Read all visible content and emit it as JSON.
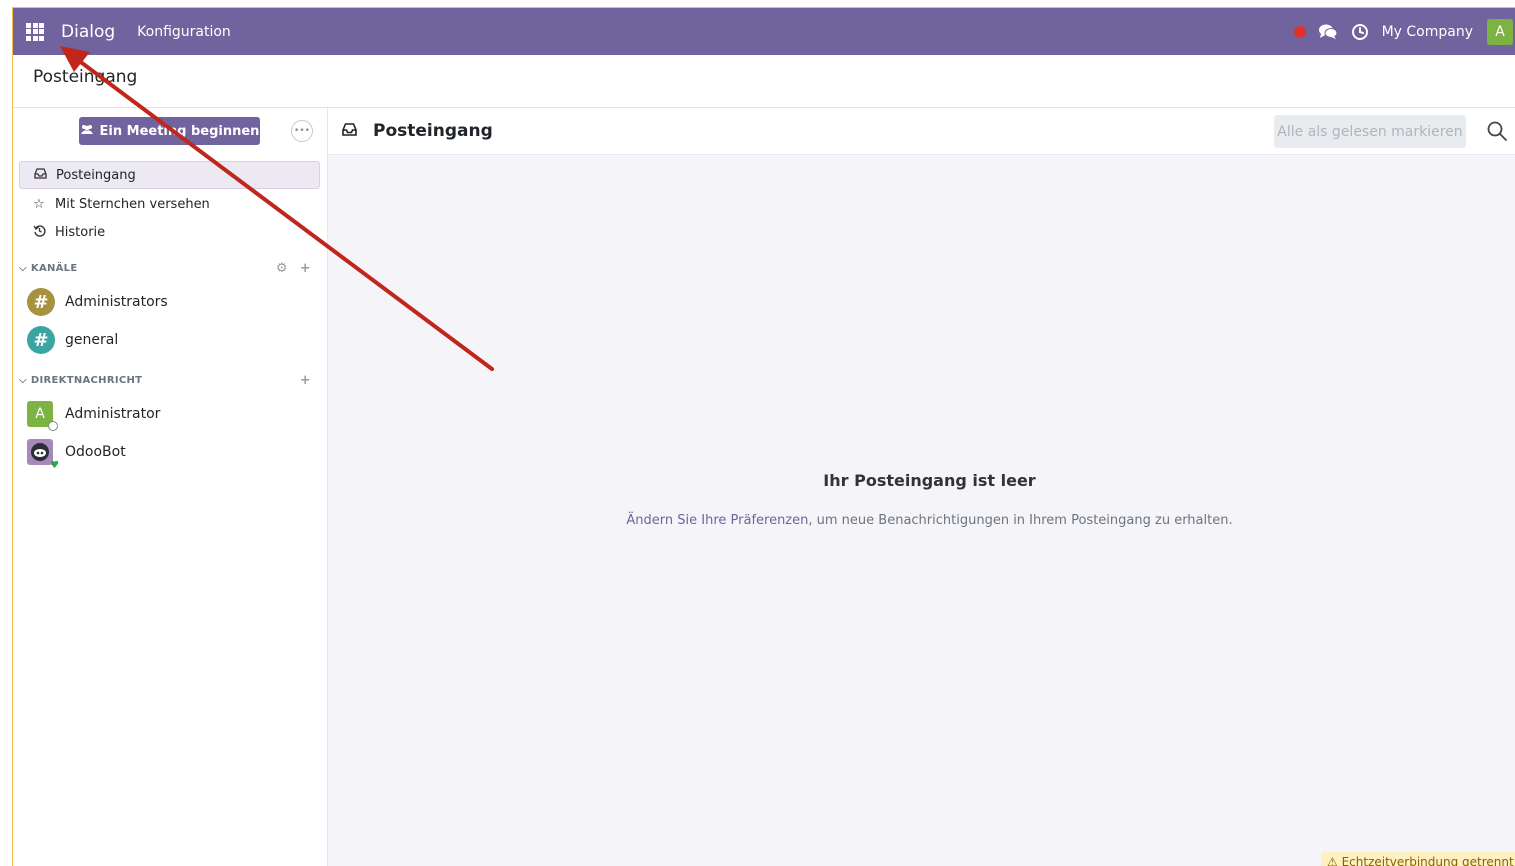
{
  "navbar": {
    "app_name": "Dialog",
    "menu": [
      "Konfiguration"
    ],
    "company": "My Company",
    "user_initial": "A"
  },
  "breadcrumb": "Posteingang",
  "sidebar": {
    "meeting_button": "Ein Meeting beginnen",
    "mailboxes": [
      {
        "label": "Posteingang",
        "icon": "inbox-icon",
        "active": true
      },
      {
        "label": "Mit Sternchen versehen",
        "icon": "star-icon",
        "active": false
      },
      {
        "label": "Historie",
        "icon": "history-icon",
        "active": false
      }
    ],
    "channels_header": "KANÄLE",
    "channels": [
      {
        "name": "Administrators",
        "color": "#a6923f"
      },
      {
        "name": "general",
        "color": "#3aa5a1"
      }
    ],
    "dm_header": "DIREKTNACHRICHT",
    "direct_messages": [
      {
        "name": "Administrator",
        "initial": "A",
        "color": "#7cb342"
      },
      {
        "name": "OdooBot",
        "color": "#a58ab8"
      }
    ]
  },
  "main": {
    "title": "Posteingang",
    "mark_all_read": "Alle als gelesen markieren",
    "empty_title": "Ihr Posteingang ist leer",
    "empty_link": "Ändern Sie Ihre Präferenzen",
    "empty_text": ", um neue Benachrichtigungen in Ihrem Posteingang zu erhalten.",
    "connection_warning": "⚠ Echtzeitverbindung getrennt"
  },
  "colors": {
    "brand": "#71639e",
    "annotation_arrow": "#c0261b"
  }
}
